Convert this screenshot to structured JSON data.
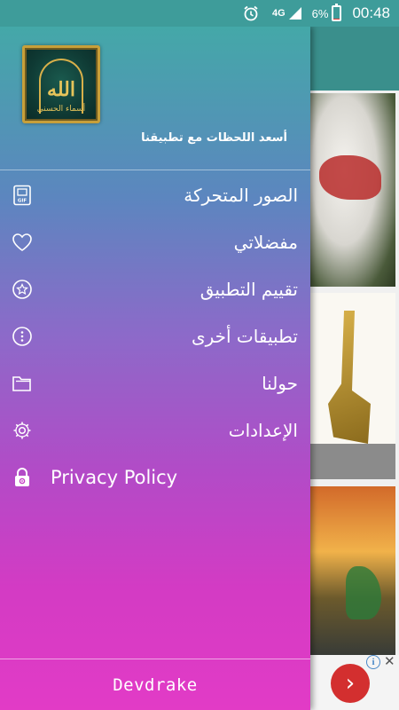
{
  "status_bar": {
    "network": "4G",
    "battery_percent": "6%",
    "battery_level": 0.06,
    "time": "00:48",
    "icons": [
      "alarm-icon",
      "signal-icon",
      "battery-icon"
    ]
  },
  "drawer": {
    "logo_text": "الله",
    "logo_subtext": "أسماء الحسنى",
    "tagline": "أسعد اللحظات مع تطبيقنا",
    "menu": [
      {
        "label": "الصور المتحركة",
        "icon": "gif-icon"
      },
      {
        "label": "مفضلاتي",
        "icon": "heart-icon"
      },
      {
        "label": "تقييم التطبيق",
        "icon": "star-badge-icon"
      },
      {
        "label": "تطبيقات أخرى",
        "icon": "more-vertical-icon"
      },
      {
        "label": "حولنا",
        "icon": "folder-icon"
      },
      {
        "label": "الإعدادات",
        "icon": "gear-icon"
      },
      {
        "label": "Privacy Policy",
        "icon": "privacy-lock-icon"
      }
    ],
    "footer": "Devdrake"
  },
  "ad": {
    "info": "i",
    "close": "✕",
    "next": "›"
  },
  "colors": {
    "status_bar": "#3e9c9a",
    "drawer_top": "#44a8a8",
    "drawer_bottom": "#e23bc6",
    "ad_button": "#d32f2f"
  }
}
